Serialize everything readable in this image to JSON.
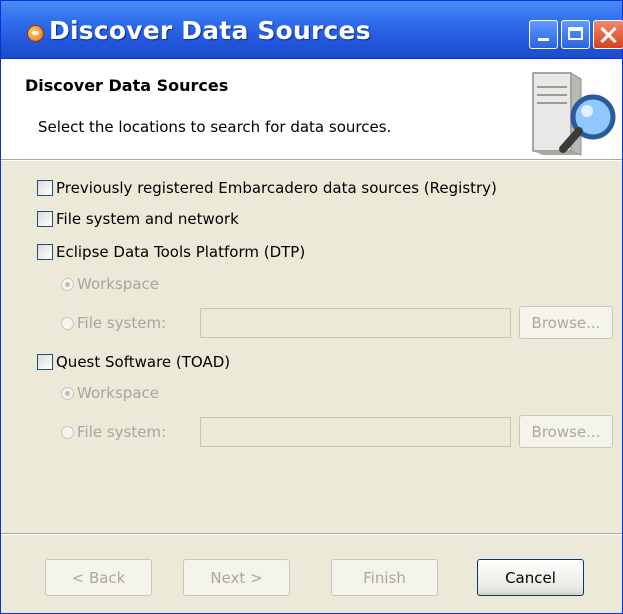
{
  "window": {
    "title": "Discover Data Sources"
  },
  "titlebar_icons": [
    "app-icon",
    "minimize-icon",
    "maximize-icon",
    "close-icon"
  ],
  "banner": {
    "title": "Discover Data Sources",
    "description": "Select the locations to search for data sources.",
    "icon": "server-magnifier-icon"
  },
  "options": {
    "registry": {
      "label": "Previously registered Embarcadero data sources (Registry)",
      "checked": false
    },
    "filesystem": {
      "label": "File system and network",
      "checked": false
    },
    "dtp": {
      "label": "Eclipse Data Tools Platform (DTP)",
      "checked": false,
      "workspace_label": "Workspace",
      "filesystem_label": "File system:",
      "selected": "Workspace",
      "path_value": "",
      "browse_label": "Browse..."
    },
    "toad": {
      "label": "Quest Software (TOAD)",
      "checked": false,
      "workspace_label": "Workspace",
      "filesystem_label": "File system:",
      "selected": "Workspace",
      "path_value": "",
      "browse_label": "Browse..."
    }
  },
  "buttons": {
    "back": "< Back",
    "next": "Next >",
    "finish": "Finish",
    "cancel": "Cancel"
  },
  "colors": {
    "titlebar": "#2357dd",
    "dialog_bg": "#ece9d8",
    "disabled_text": "#a7a69b",
    "close_button": "#d7421c"
  }
}
